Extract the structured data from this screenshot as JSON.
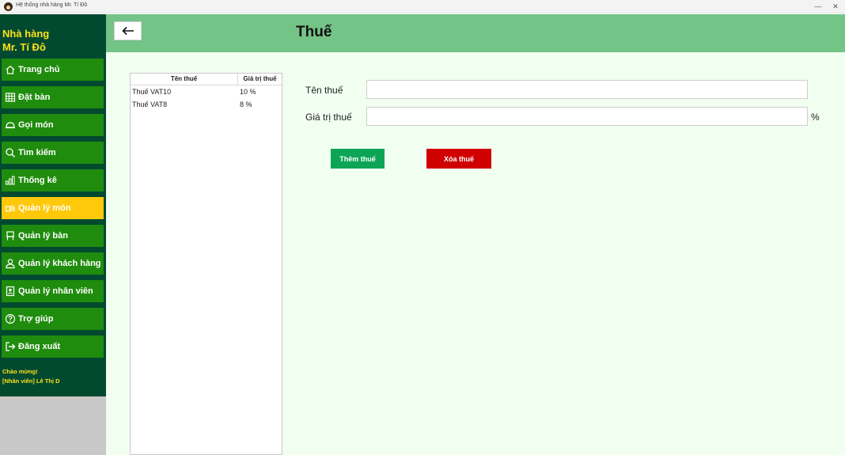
{
  "window": {
    "title": "Hệ thống nhà hàng Mr. Tí Đô",
    "minimize": "—",
    "close": "✕"
  },
  "sidebar": {
    "brand_line1": "Nhà hàng",
    "brand_line2": "Mr. Tí Đô",
    "items": [
      {
        "label": "Trang chủ",
        "icon": "home-icon",
        "active": false
      },
      {
        "label": "Đặt bàn",
        "icon": "table-grid-icon",
        "active": false
      },
      {
        "label": "Gọi món",
        "icon": "food-cover-icon",
        "active": false
      },
      {
        "label": "Tìm kiếm",
        "icon": "search-icon",
        "active": false
      },
      {
        "label": "Thống kê",
        "icon": "bar-chart-icon",
        "active": false
      },
      {
        "label": "Quản lý món",
        "icon": "dish-icon",
        "active": true
      },
      {
        "label": "Quản lý bàn",
        "icon": "chair-icon",
        "active": false
      },
      {
        "label": "Quản lý khách hàng",
        "icon": "user-icon",
        "active": false
      },
      {
        "label": "Quản lý nhân viên",
        "icon": "id-card-icon",
        "active": false
      },
      {
        "label": "Trợ giúp",
        "icon": "help-icon",
        "active": false
      },
      {
        "label": "Đăng xuất",
        "icon": "logout-icon",
        "active": false
      }
    ],
    "greeting_line1": "Chào mừng!",
    "greeting_line2": "[Nhân viên] Lê Thị D"
  },
  "header": {
    "title": "Thuế",
    "back_icon": "arrow-left-icon"
  },
  "tax_table": {
    "columns": [
      "Tên thuế",
      "Giá trị thuế"
    ],
    "rows": [
      {
        "name": "Thuế VAT10",
        "value": "10 %"
      },
      {
        "name": "Thuế VAT8",
        "value": "8 %"
      }
    ]
  },
  "form": {
    "name_label": "Tên thuế",
    "name_value": "",
    "value_label": "Giá trị thuế",
    "value_value": "",
    "percent": "%",
    "add_button": "Thêm thuế",
    "delete_button": "Xóa thuế"
  },
  "colors": {
    "sidebar_bg": "#024a2f",
    "nav_item": "#1f8c0d",
    "nav_active": "#ffc90b",
    "brand_text": "#ffe11a",
    "header_bg": "#74c387",
    "main_bg": "#f1fff1",
    "add_button": "#0ba555",
    "delete_button": "#d10000"
  }
}
